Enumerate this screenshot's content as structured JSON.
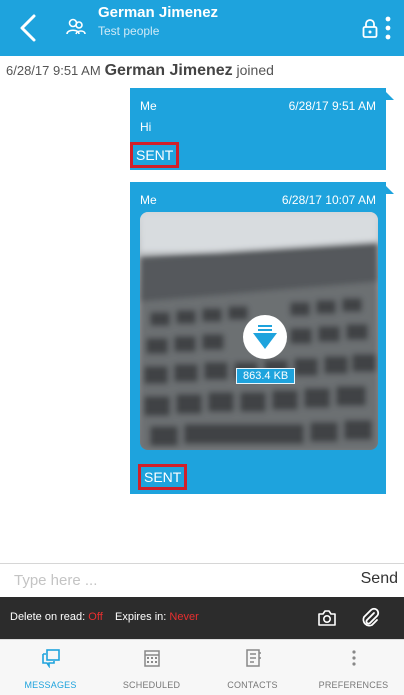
{
  "header": {
    "contact_name": "German Jimenez",
    "contact_subtitle": "Test people"
  },
  "joined_event": {
    "timestamp": "6/28/17 9:51 AM",
    "name": "German Jimenez",
    "suffix": "joined"
  },
  "messages": [
    {
      "sender": "Me",
      "time": "6/28/17 9:51 AM",
      "text": "Hi",
      "status": "SENT"
    },
    {
      "sender": "Me",
      "time": "6/28/17 10:07 AM",
      "attachment": {
        "type": "image",
        "size": "863.4 KB"
      },
      "status": "SENT"
    }
  ],
  "composer": {
    "placeholder": "Type here ...",
    "send_label": "Send"
  },
  "options_bar": {
    "delete_on_read_label": "Delete on read:",
    "delete_on_read_value": "Off",
    "expires_label": "Expires in:",
    "expires_value": "Never"
  },
  "tabs": [
    {
      "label": "MESSAGES",
      "icon": "messages-icon",
      "active": true
    },
    {
      "label": "SCHEDULED",
      "icon": "calendar-icon",
      "active": false
    },
    {
      "label": "CONTACTS",
      "icon": "contacts-icon",
      "active": false
    },
    {
      "label": "PREFERENCES",
      "icon": "more-vertical-icon",
      "active": false
    }
  ],
  "colors": {
    "accent": "#1ea3dd",
    "highlight_border": "#d0202a",
    "warning_text": "#e82f2f",
    "options_bar_bg": "#2c2c2c"
  }
}
